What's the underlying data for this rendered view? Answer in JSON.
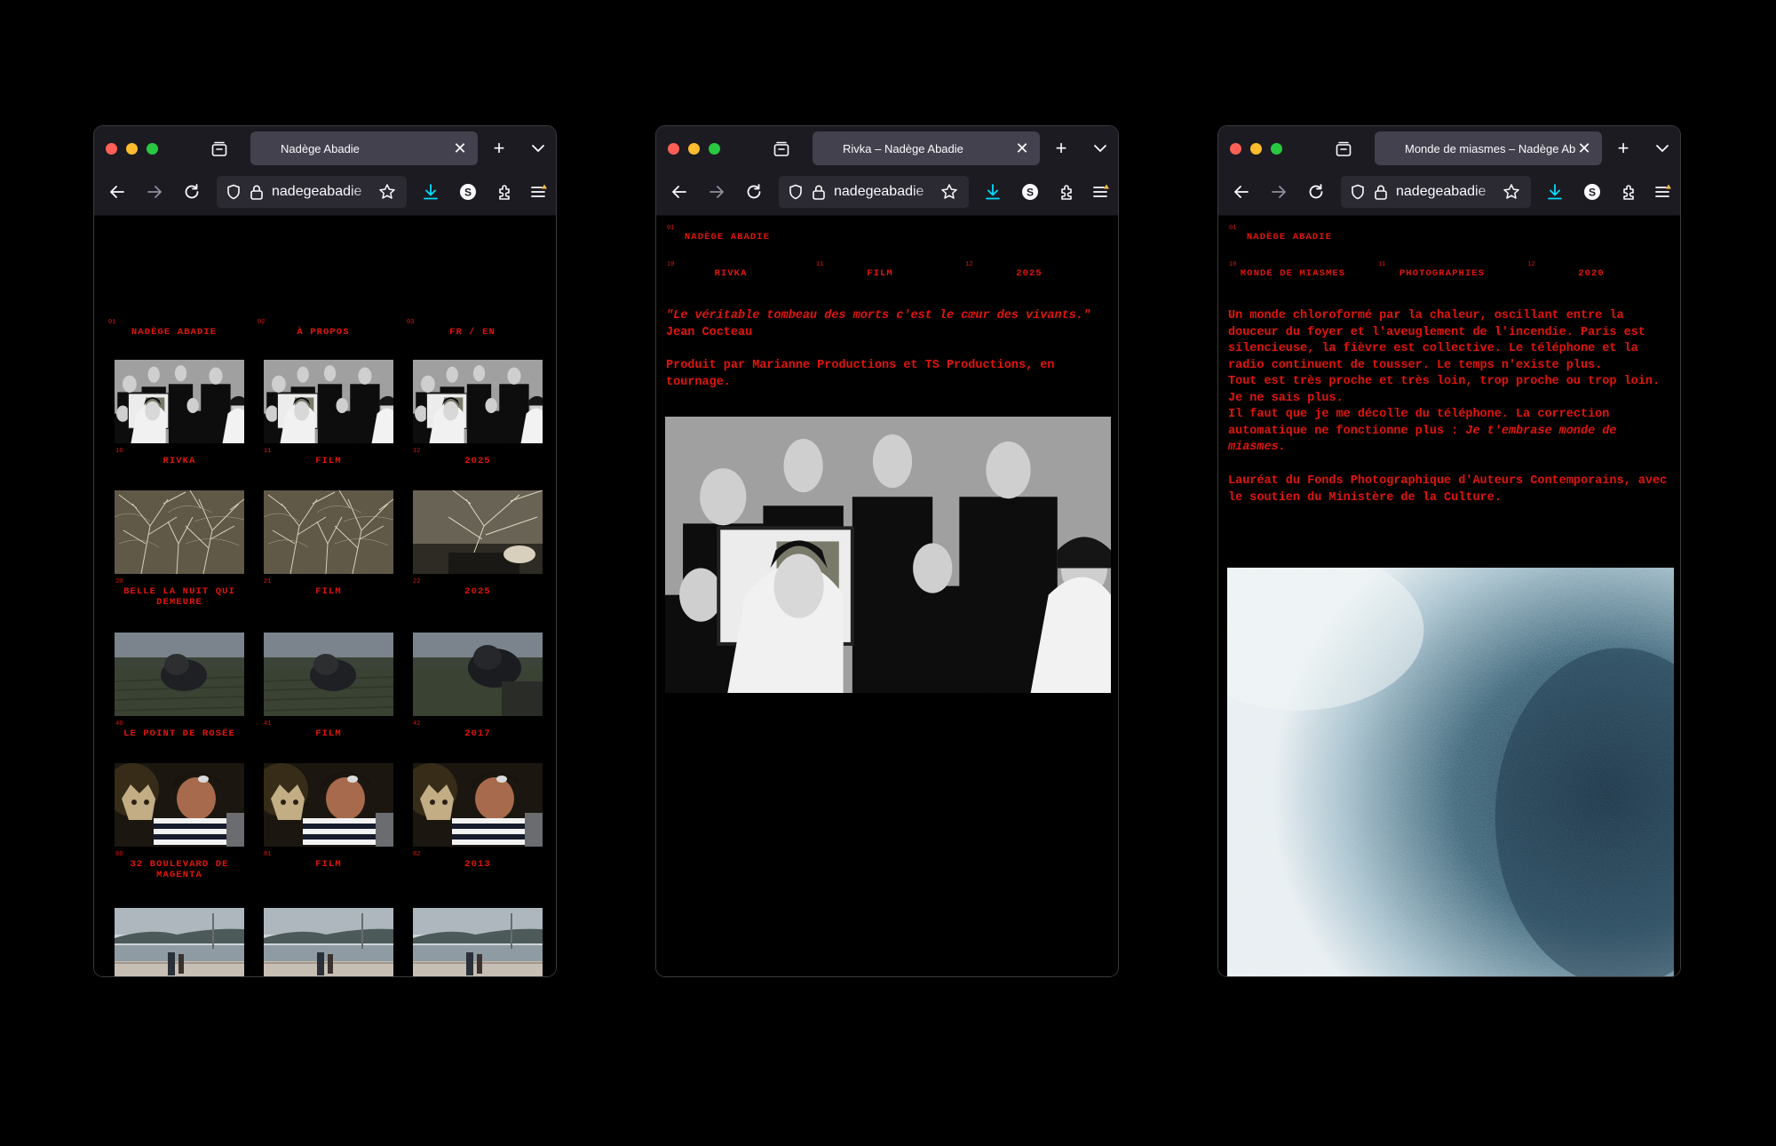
{
  "browser": {
    "url": "nadegeabadie",
    "colors": {
      "chrome": "#1c1b22",
      "tab_active": "#42414d",
      "url_bar": "#2b2a33",
      "accent_download": "#00ddff",
      "site_text": "#e1150c"
    }
  },
  "windows": [
    {
      "tab_title": "Nadège Abadie"
    },
    {
      "tab_title": "Rivka – Nadège Abadie"
    },
    {
      "tab_title": "Monde de miasmes – Nadège Abadie"
    }
  ],
  "index_page": {
    "header": [
      {
        "num": "01",
        "label": "NADÈGE ABADIE"
      },
      {
        "num": "02",
        "label": "À PROPOS"
      },
      {
        "num": "03",
        "label": "FR / EN"
      }
    ],
    "projects": [
      {
        "nums": [
          "10",
          "11",
          "12"
        ],
        "title": "RIVKA",
        "type": "FILM",
        "year": "2025",
        "image": "group-portrait-bw"
      },
      {
        "nums": [
          "20",
          "21",
          "22"
        ],
        "title": "BELLE LA NUIT QUI DEMEURE",
        "type": "FILM",
        "year": "2025",
        "image": "winter-trees-sepia"
      },
      {
        "nums": [
          "40",
          "41",
          "42"
        ],
        "title": "LE POINT DE ROSÉE",
        "type": "FILM",
        "year": "2017",
        "image": "dusk-field-figure"
      },
      {
        "nums": [
          "80",
          "81",
          "82"
        ],
        "title": "32 BOULEVARD DE MAGENTA",
        "type": "FILM",
        "year": "2013",
        "image": "girl-with-mask"
      },
      {
        "nums": [
          "",
          "",
          ""
        ],
        "title": "",
        "type": "",
        "year": "",
        "image": "seaside-promenade"
      }
    ]
  },
  "rivka_page": {
    "header": {
      "num": "01",
      "label": "NADÈGE ABADIE"
    },
    "meta": [
      {
        "num": "10",
        "label": "RIVKA"
      },
      {
        "num": "11",
        "label": "FILM"
      },
      {
        "num": "12",
        "label": "2025"
      }
    ],
    "quote": "\"Le véritable tombeau des morts c'est le cœur des vivants.\"",
    "quote_author": "Jean Cocteau",
    "credit": "Produit par Marianne Productions et TS Productions, en tournage.",
    "image": "group-portrait-bw"
  },
  "miasmes_page": {
    "header": {
      "num": "01",
      "label": "NADÈGE ABADIE"
    },
    "meta": [
      {
        "num": "10",
        "label": "MONDE DE MIASMES"
      },
      {
        "num": "11",
        "label": "PHOTOGRAPHIES"
      },
      {
        "num": "12",
        "label": "2020"
      }
    ],
    "text_1": "Un monde chloroformé par la chaleur, oscillant entre la douceur du foyer et l'aveuglement de l'incendie. Paris est silencieuse, la fièvre est collective. Le téléphone et la radio continuent de tousser. Le temps n'existe plus.",
    "text_2": "Tout est très proche et très loin, trop proche ou trop loin. Je ne sais plus.",
    "text_3": "Il faut que je me décolle du téléphone. La correction automatique ne fonctionne plus :",
    "text_3_italic": "Je t'embrase monde de miasmes.",
    "text_4": "Lauréat du Fonds Photographique d'Auteurs Contemporains, avec le soutien du Ministère de la Culture.",
    "image": "blue-frost-texture"
  }
}
